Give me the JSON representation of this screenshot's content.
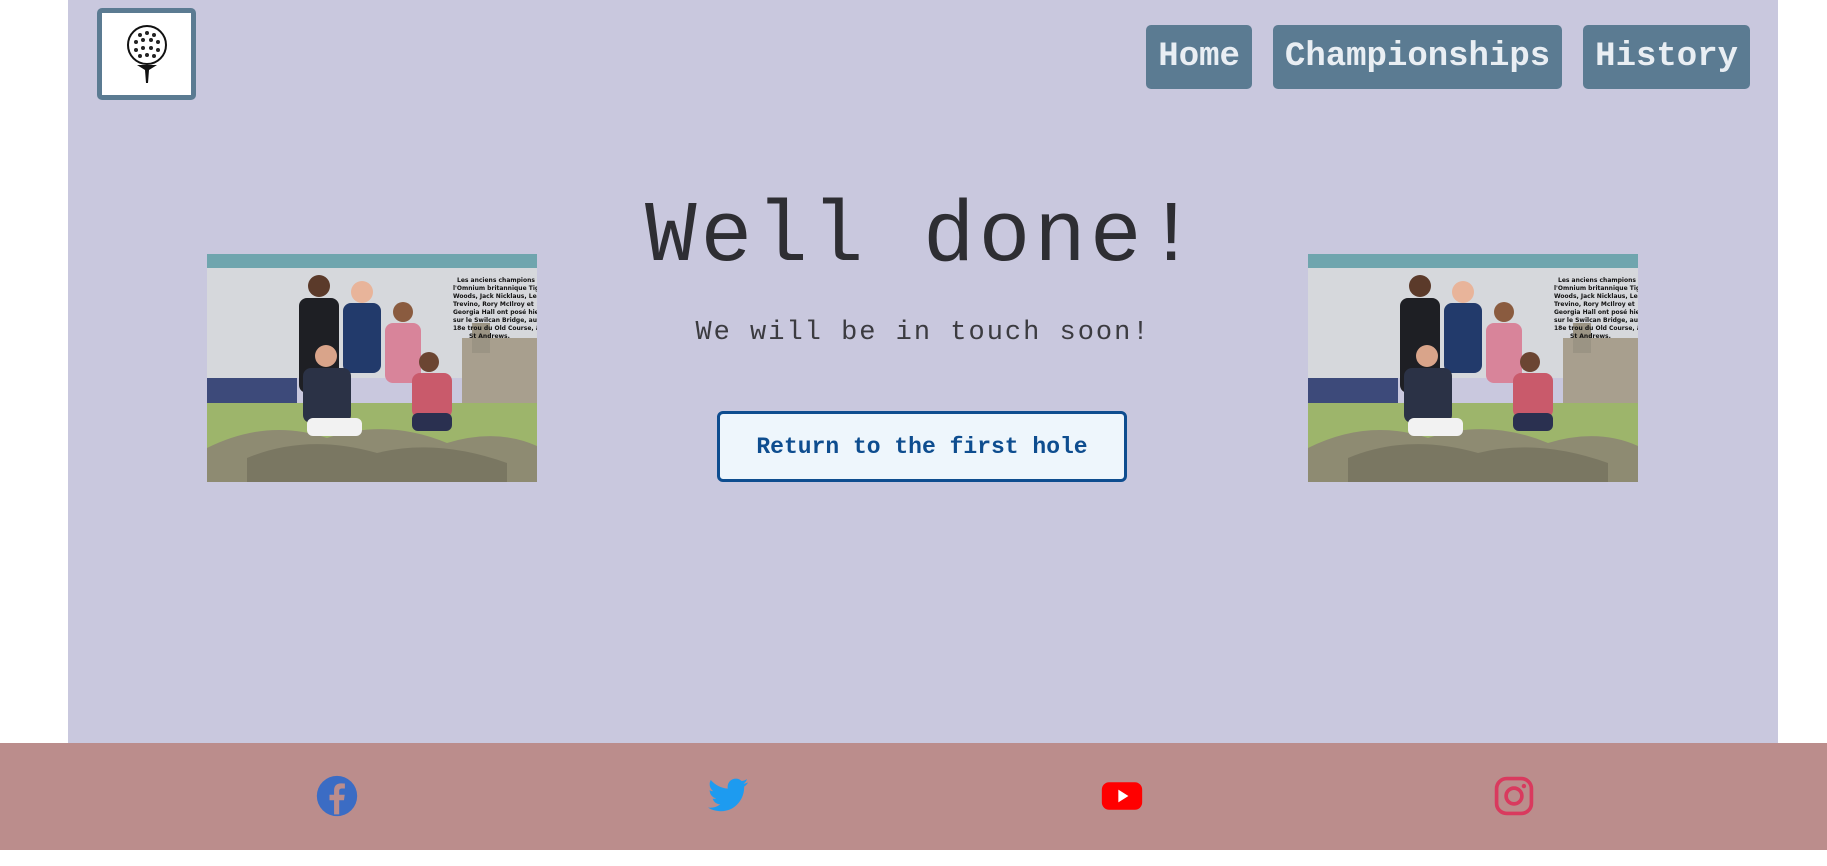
{
  "header": {
    "logo_icon": "golf-ball-on-tee-icon",
    "nav": [
      {
        "label": "Home"
      },
      {
        "label": "Championships"
      },
      {
        "label": "History"
      }
    ]
  },
  "main": {
    "headline": "Well done!",
    "subline": "We will be in touch soon!",
    "cta_label": "Return to the first hole",
    "photo_caption": "Les anciens champions de l'Omnium britannique Tiger Woods, Jack Nicklaus, Lee Trevino, Rory McIlroy et Georgia Hall ont posé hier sur le Swilcan Bridge, au 18e trou du Old Course, à St Andrews."
  },
  "footer": {
    "social": [
      {
        "icon": "facebook-icon",
        "color": "#3b6cc4"
      },
      {
        "icon": "twitter-icon",
        "color": "#1d9bf0"
      },
      {
        "icon": "youtube-icon",
        "color": "#ff0000"
      },
      {
        "icon": "instagram-icon",
        "color": "#d93a5e"
      }
    ]
  },
  "colors": {
    "page_bg": "#c9c8de",
    "nav_bg": "#5b7b92",
    "cta_border": "#0e4d8f",
    "footer_bg": "#bb8d8c"
  }
}
